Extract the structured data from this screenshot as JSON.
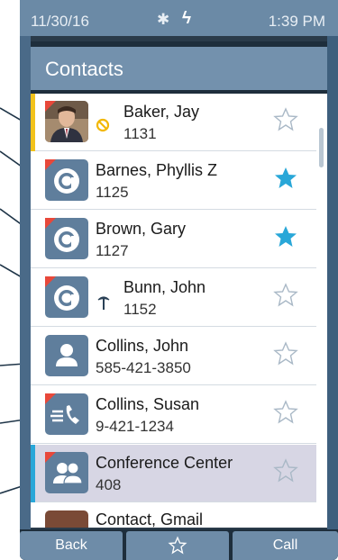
{
  "status": {
    "date": "11/30/16",
    "bluetooth_icon": "bluetooth-icon",
    "bolt_icon": "lightning-icon",
    "time": "1:39 PM"
  },
  "title": "Contacts",
  "contacts": [
    {
      "name": "Baker, Jay",
      "number": "1131",
      "avatar": "photo",
      "presence": "do-not-disturb-icon",
      "favorite": false,
      "indicator": "#f2c21b"
    },
    {
      "name": "Barnes, Phyllis Z",
      "number": "1125",
      "avatar": "app-icon",
      "presence": "",
      "favorite": true,
      "indicator": ""
    },
    {
      "name": "Brown, Gary",
      "number": "1127",
      "avatar": "app-icon",
      "presence": "",
      "favorite": true,
      "indicator": ""
    },
    {
      "name": "Bunn, John",
      "number": "1152",
      "avatar": "app-icon",
      "presence": "vacation-icon",
      "favorite": false,
      "indicator": ""
    },
    {
      "name": "Collins, John",
      "number": "585-421-3850",
      "avatar": "person-icon",
      "presence": "",
      "favorite": false,
      "indicator": ""
    },
    {
      "name": "Collins, Susan",
      "number": "9-421-1234",
      "avatar": "phone-icon",
      "presence": "",
      "favorite": false,
      "indicator": ""
    },
    {
      "name": "Conference Center",
      "number": "408",
      "avatar": "group-icon",
      "presence": "",
      "favorite": false,
      "indicator": "#29a7d8"
    },
    {
      "name": "Contact, Gmail",
      "number": "",
      "avatar": "photo",
      "presence": "",
      "favorite": false,
      "indicator": ""
    }
  ],
  "buttons": {
    "back": "Back",
    "favorite_icon": "star-outline-icon",
    "call": "Call"
  },
  "colors": {
    "accent": "#29a7d8",
    "favorite": "#29a7d8",
    "status_bar": "#6b8aa6"
  }
}
